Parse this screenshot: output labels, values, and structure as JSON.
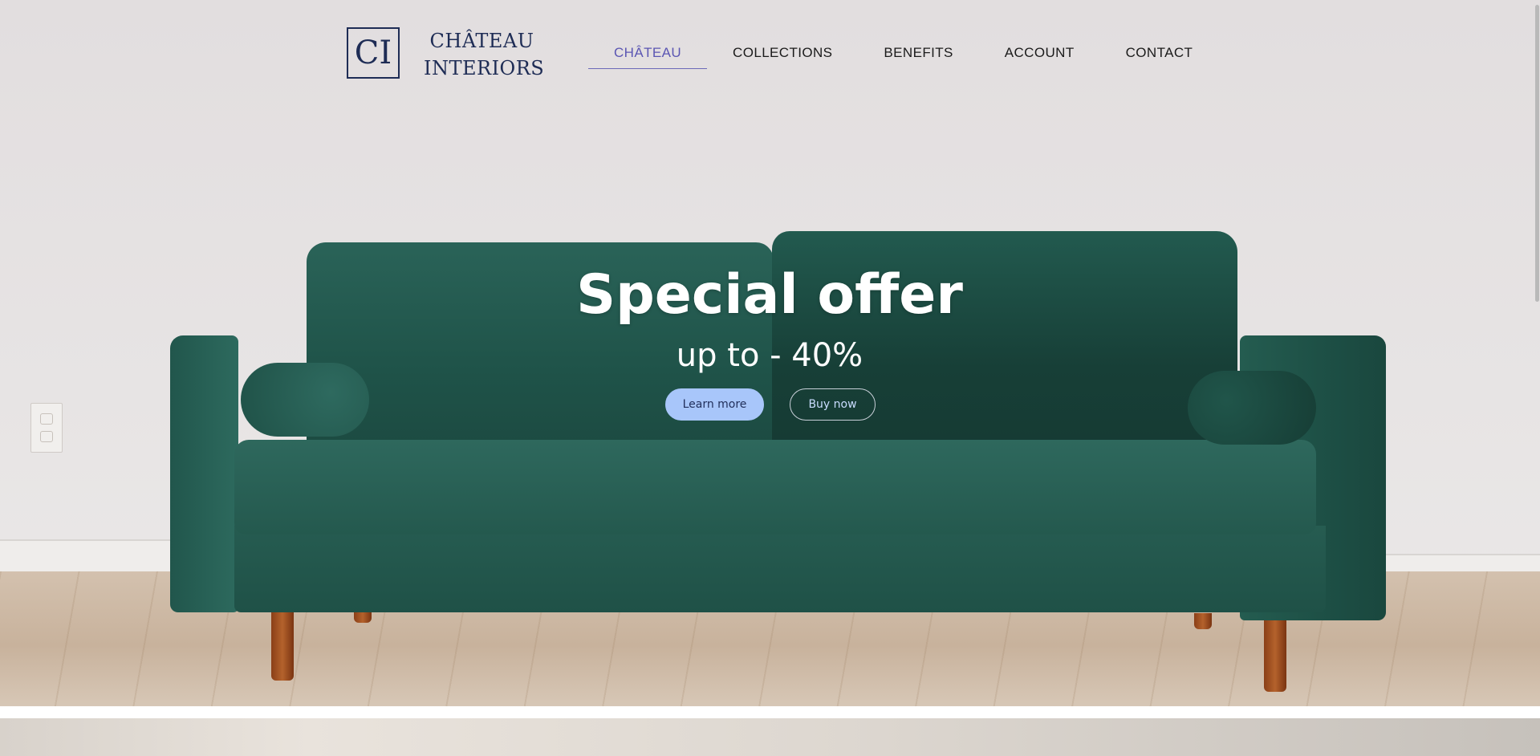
{
  "brand": {
    "monogram": "CI",
    "name_line1": "CHÂTEAU",
    "name_line2": "INTERIORS"
  },
  "nav": {
    "items": [
      {
        "label": "CHÂTEAU",
        "active": true
      },
      {
        "label": "COLLECTIONS",
        "active": false
      },
      {
        "label": "BENEFITS",
        "active": false
      },
      {
        "label": "ACCOUNT",
        "active": false
      },
      {
        "label": "CONTACT",
        "active": false
      }
    ]
  },
  "hero": {
    "title": "Special offer",
    "subtitle": "up to - 40%",
    "primary_button": "Learn more",
    "secondary_button": "Buy now",
    "image": "green-velvet-sofa"
  },
  "colors": {
    "brand_navy": "#1e2c55",
    "nav_active": "#5b56b3",
    "button_primary": "#a8c6fa",
    "sofa_green": "#24594e"
  }
}
